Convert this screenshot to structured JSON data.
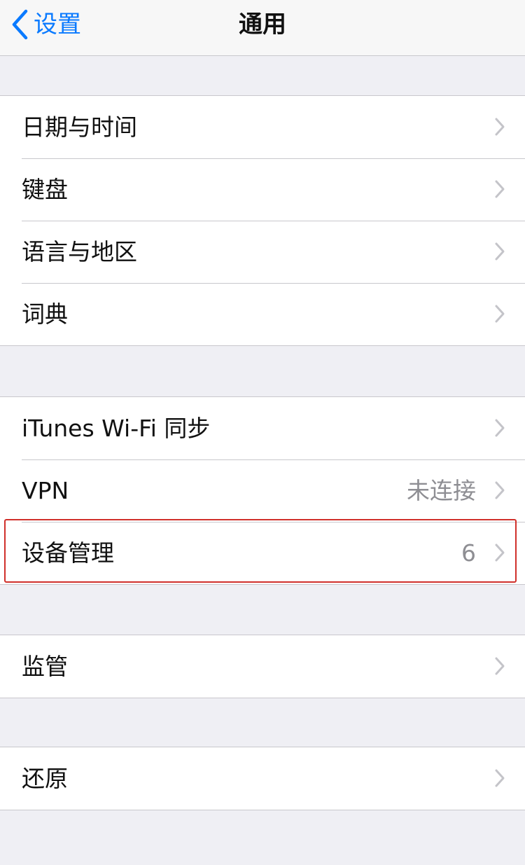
{
  "navbar": {
    "back_label": "设置",
    "title": "通用"
  },
  "groups": [
    {
      "items": [
        {
          "label": "日期与时间",
          "detail": ""
        },
        {
          "label": "键盘",
          "detail": ""
        },
        {
          "label": "语言与地区",
          "detail": ""
        },
        {
          "label": "词典",
          "detail": ""
        }
      ]
    },
    {
      "items": [
        {
          "label": "iTunes Wi-Fi 同步",
          "detail": ""
        },
        {
          "label": "VPN",
          "detail": "未连接"
        },
        {
          "label": "设备管理",
          "detail": "6"
        }
      ]
    },
    {
      "items": [
        {
          "label": "监管",
          "detail": ""
        }
      ]
    },
    {
      "items": [
        {
          "label": "还原",
          "detail": ""
        }
      ]
    }
  ],
  "colors": {
    "accent": "#0a7aff",
    "highlight_box": "#d0302b",
    "background": "#efeff4"
  }
}
